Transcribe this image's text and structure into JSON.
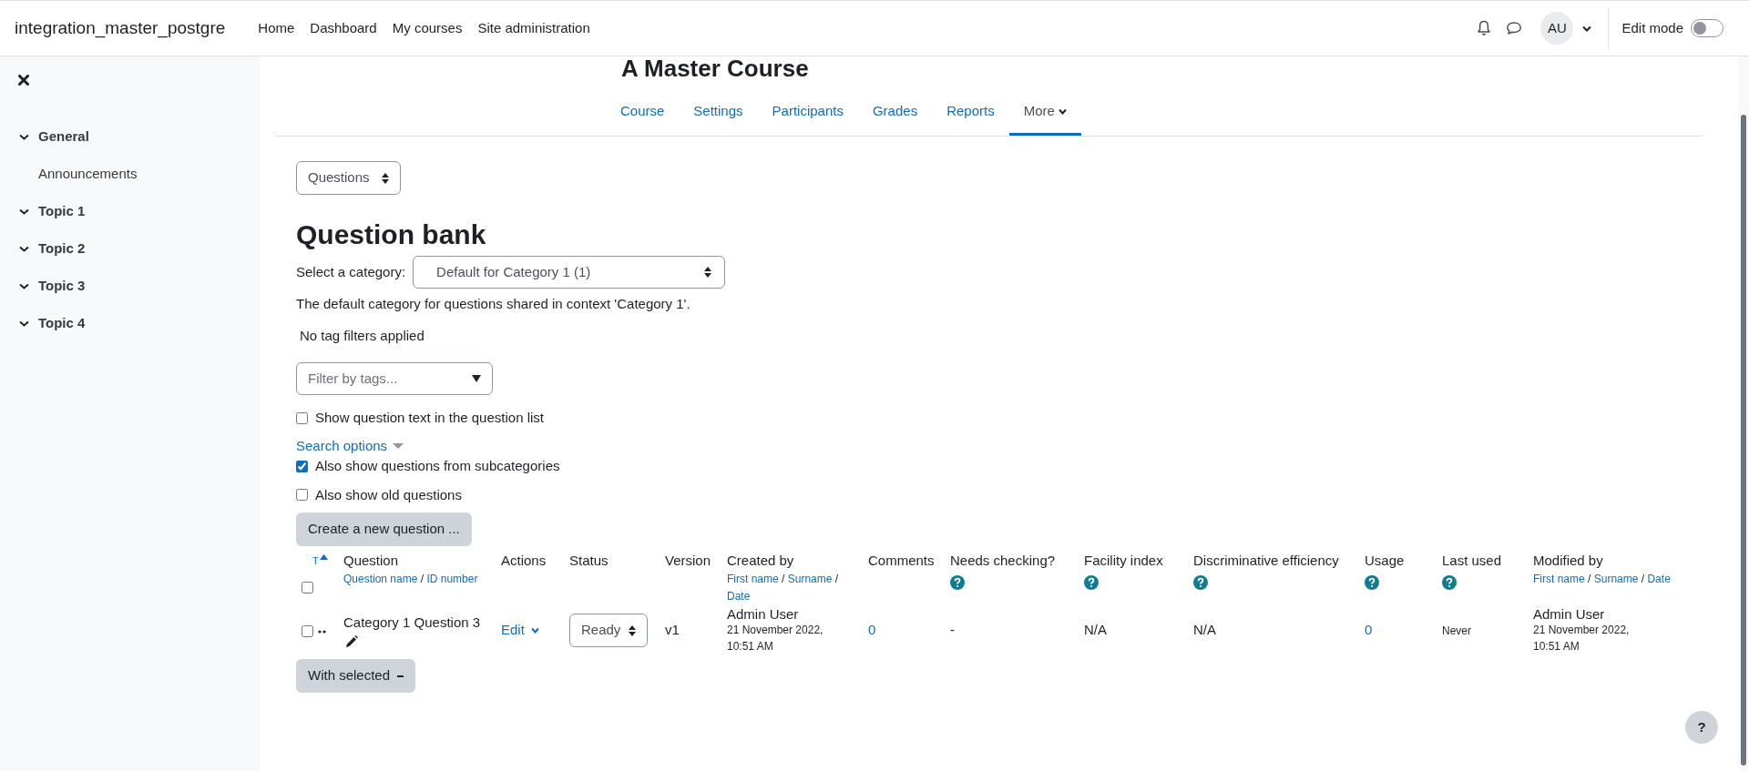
{
  "navbar": {
    "brand": "integration_master_postgre",
    "links": [
      "Home",
      "Dashboard",
      "My courses",
      "Site administration"
    ],
    "avatar": "AU",
    "edit_mode": {
      "label": "Edit mode",
      "on": false
    }
  },
  "sidebar": {
    "items": [
      {
        "label": "General",
        "expanded": true,
        "children": [
          {
            "label": "Announcements"
          }
        ]
      },
      {
        "label": "Topic 1",
        "expanded": true
      },
      {
        "label": "Topic 2",
        "expanded": true
      },
      {
        "label": "Topic 3",
        "expanded": true
      },
      {
        "label": "Topic 4",
        "expanded": true
      }
    ]
  },
  "course_title": "A Master Course",
  "tabs": [
    {
      "label": "Course",
      "selected": false
    },
    {
      "label": "Settings",
      "selected": false
    },
    {
      "label": "Participants",
      "selected": false
    },
    {
      "label": "Grades",
      "selected": false
    },
    {
      "label": "Reports",
      "selected": false
    },
    {
      "label": "More",
      "selected": true,
      "menu": true
    }
  ],
  "page_select": "Questions",
  "heading": "Question bank",
  "category": {
    "label": "Select a category:",
    "value": "Default for Category 1 (1)",
    "note": "The default category for questions shared in context 'Category 1'."
  },
  "tag_note": "No tag filters applied",
  "tag_filter": {
    "placeholder": "Filter by tags..."
  },
  "show_text": {
    "label": "Show question text in the question list",
    "checked": false
  },
  "search_options": "Search options",
  "options": [
    {
      "label": "Also show questions from subcategories",
      "checked": true
    },
    {
      "label": "Also show old questions",
      "checked": false
    }
  ],
  "create_button": "Create a new question ...",
  "table": {
    "sort_mark": "T",
    "select_all": false,
    "columns": [
      {
        "label": "Question",
        "help": false,
        "sort_links": [
          {
            "kind": "link",
            "text": "Question name"
          },
          {
            "kind": "sep",
            "text": "/"
          },
          {
            "kind": "link",
            "text": "ID number"
          }
        ]
      },
      {
        "label": "Actions",
        "help": false
      },
      {
        "label": "Status",
        "help": false
      },
      {
        "label": "Version",
        "help": false
      },
      {
        "label": "Created by",
        "help": false,
        "sort_links": [
          {
            "kind": "link",
            "text": "First name"
          },
          {
            "kind": "sep",
            "text": "/"
          },
          {
            "kind": "link",
            "text": "Surname"
          },
          {
            "kind": "sep",
            "text": "/"
          },
          {
            "kind": "link",
            "text": "Date"
          }
        ]
      },
      {
        "label": "Comments",
        "help": false
      },
      {
        "label": "Needs checking?",
        "help": true
      },
      {
        "label": "Facility index",
        "help": true
      },
      {
        "label": "Discriminative efficiency",
        "help": true
      },
      {
        "label": "Usage",
        "help": true
      },
      {
        "label": "Last used",
        "help": true
      },
      {
        "label": "Modified by",
        "help": false,
        "sort_links": [
          {
            "kind": "link",
            "text": "First name"
          },
          {
            "kind": "sep",
            "text": "/"
          },
          {
            "kind": "link",
            "text": "Surname"
          },
          {
            "kind": "sep",
            "text": "/"
          },
          {
            "kind": "link",
            "text": "Date"
          }
        ]
      }
    ],
    "rows": [
      {
        "checked": false,
        "cells": [
          {
            "kind": "question",
            "text": "Category 1 Question 3"
          },
          {
            "kind": "menu",
            "text": "Edit"
          },
          {
            "kind": "select",
            "text": "Ready"
          },
          {
            "kind": "text",
            "text": "v1"
          },
          {
            "kind": "person",
            "name": "Admin User",
            "date": "21 November 2022, 10:51 AM"
          },
          {
            "kind": "link",
            "text": "0"
          },
          {
            "kind": "text",
            "text": "-"
          },
          {
            "kind": "text",
            "text": "N/A"
          },
          {
            "kind": "text",
            "text": "N/A"
          },
          {
            "kind": "link",
            "text": "0"
          },
          {
            "kind": "small",
            "text": "Never"
          },
          {
            "kind": "person",
            "name": "Admin User",
            "date": "21 November 2022, 10:51 AM"
          }
        ]
      }
    ]
  },
  "with_selected": "With selected",
  "help_button": "?"
}
